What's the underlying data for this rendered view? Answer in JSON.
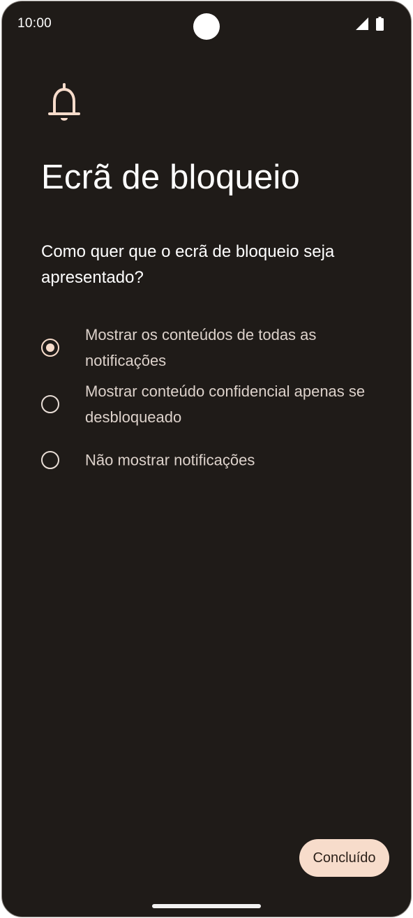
{
  "status_bar": {
    "time": "10:00"
  },
  "header": {
    "icon": "bell-icon",
    "title": "Ecrã de bloqueio"
  },
  "question": "Como quer que o ecrã de bloqueio seja apresentado?",
  "options": [
    {
      "label": "Mostrar os conteúdos de todas as notificações",
      "selected": true
    },
    {
      "label": "Mostrar conteúdo confidencial apenas se desbloqueado",
      "selected": false
    },
    {
      "label": "Não mostrar notificações",
      "selected": false
    }
  ],
  "footer": {
    "done_label": "Concluído"
  },
  "colors": {
    "background": "#1f1b18",
    "accent": "#f7dccb",
    "text_primary": "#ffffff",
    "text_secondary": "#ddd2cb"
  }
}
